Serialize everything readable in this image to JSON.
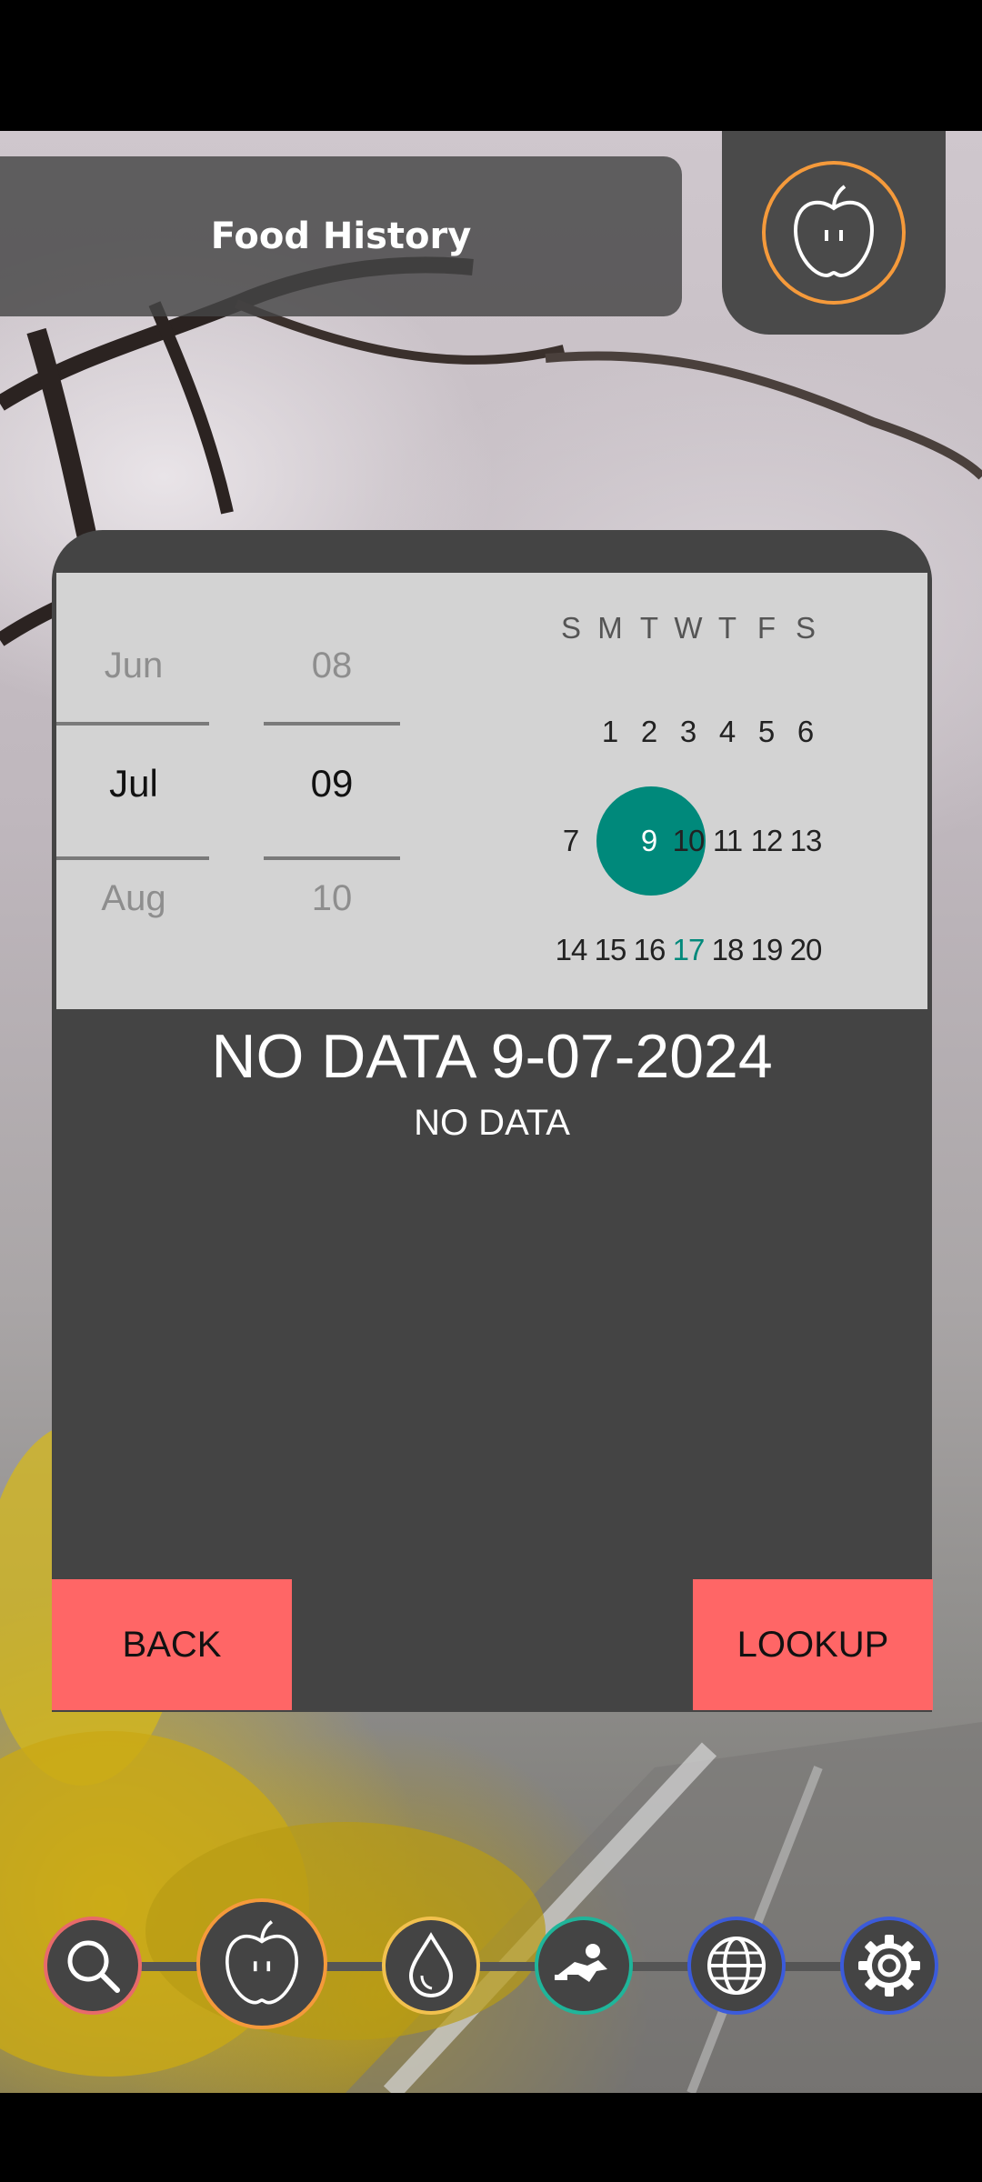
{
  "header": {
    "title": "Food History"
  },
  "icons": {
    "profile": "apple-icon",
    "nav": [
      "search-icon",
      "apple-icon",
      "water-drop-icon",
      "exercise-icon",
      "globe-icon",
      "gear-icon"
    ]
  },
  "colors": {
    "accent_orange": "#f59a3b",
    "selected_day": "#00897b",
    "button": "#ff6666",
    "nav_search_ring": "#e86a6a",
    "nav_water_ring": "#f2c14e",
    "nav_exercise_ring": "#1fb59a",
    "nav_globe_ring": "#3b5bdb",
    "nav_settings_ring": "#3b5bdb"
  },
  "date_picker": {
    "month_prev": "Jun",
    "month_selected": "Jul",
    "month_next": "Aug",
    "day_prev": "08",
    "day_selected": "09",
    "day_next": "10"
  },
  "calendar": {
    "weekdays": [
      "S",
      "M",
      "T",
      "W",
      "T",
      "F",
      "S"
    ],
    "week1": [
      "1",
      "2",
      "3",
      "4",
      "5",
      "6"
    ],
    "week2": [
      "7",
      "9",
      "10",
      "11",
      "12",
      "13"
    ],
    "week3": [
      "14",
      "15",
      "16",
      "17",
      "18",
      "19",
      "20"
    ],
    "selected_day": "9",
    "today": "17"
  },
  "result": {
    "title": "NO DATA 9-07-2024",
    "subtitle": "NO DATA"
  },
  "buttons": {
    "back": "BACK",
    "lookup": "LOOKUP"
  }
}
